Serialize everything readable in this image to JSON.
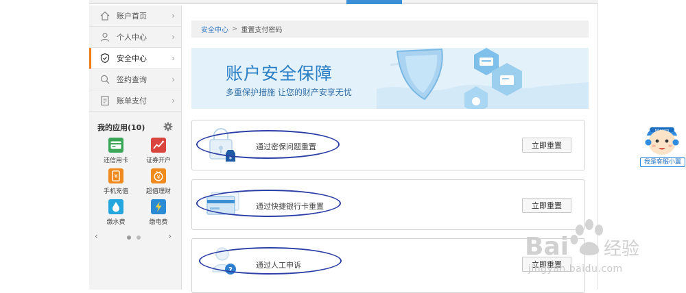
{
  "sidebar": {
    "nav": [
      {
        "label": "账户首页",
        "icon": "home-icon"
      },
      {
        "label": "个人中心",
        "icon": "user-icon"
      },
      {
        "label": "安全中心",
        "icon": "shield-icon",
        "active": true
      },
      {
        "label": "签约查询",
        "icon": "search-icon"
      },
      {
        "label": "账单支付",
        "icon": "bill-icon"
      }
    ],
    "apps_title": "我的应用(10)",
    "apps": [
      {
        "label": "还信用卡",
        "color": "#3aa657",
        "icon": "credit-card-icon"
      },
      {
        "label": "证券开户",
        "color": "#d9453e",
        "icon": "chart-icon"
      },
      {
        "label": "手机充值",
        "color": "#f08a1c",
        "icon": "phone-icon"
      },
      {
        "label": "超值理财",
        "color": "#f08a1c",
        "icon": "coin-icon"
      },
      {
        "label": "缴水费",
        "color": "#25a5dd",
        "icon": "water-drop-icon"
      },
      {
        "label": "缴电费",
        "color": "#2b8ad4",
        "icon": "lightning-icon"
      }
    ]
  },
  "breadcrumb": {
    "link": "安全中心",
    "separator": ">",
    "current": "重置支付密码"
  },
  "banner": {
    "title": "账户安全保障",
    "subtitle": "多重保护措施 让您的财产安享无忧"
  },
  "cards": [
    {
      "text": "通过密保问题重置",
      "button": "立即重置",
      "icon": "lock-question-icon"
    },
    {
      "text": "通过快捷银行卡重置",
      "button": "立即重置",
      "icon": "bank-card-icon"
    },
    {
      "text": "通过人工申诉",
      "button": "立即重置",
      "icon": "manual-appeal-icon"
    }
  ],
  "service": {
    "label": "我是客服小翼"
  },
  "watermark": {
    "text": "Bai经验",
    "url": "jingyan.baidu.com"
  },
  "colors": {
    "accent": "#f07d1a",
    "link": "#3278c2",
    "brand_blue": "#2a7fc5",
    "annotation": "#2c3fa6"
  }
}
